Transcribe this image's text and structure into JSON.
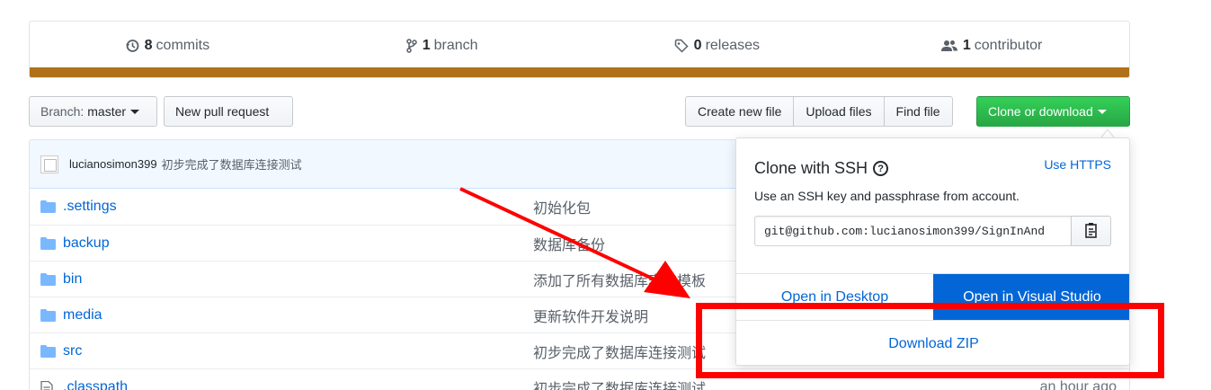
{
  "summary": {
    "commits": {
      "count": "8",
      "label": "commits",
      "icon": "history-icon"
    },
    "branches": {
      "count": "1",
      "label": "branch",
      "icon": "git-branch-icon"
    },
    "releases": {
      "count": "0",
      "label": "releases",
      "icon": "tag-icon"
    },
    "contributors": {
      "count": "1",
      "label": "contributor",
      "icon": "people-icon"
    },
    "language_color": "#b07219"
  },
  "toolbar": {
    "branch_prefix": "Branch:",
    "branch_name": "master",
    "new_pull_request": "New pull request",
    "create_new_file": "Create new file",
    "upload_files": "Upload files",
    "find_file": "Find file",
    "clone_or_download": "Clone or download"
  },
  "commit": {
    "author": "lucianosimon399",
    "message": "初步完成了数据库连接测试"
  },
  "files": [
    {
      "name": ".settings",
      "type": "folder",
      "message": "初始化包",
      "age": ""
    },
    {
      "name": "backup",
      "type": "folder",
      "message": "数据库备份",
      "age": ""
    },
    {
      "name": "bin",
      "type": "folder",
      "message": "添加了所有数据库表的模板",
      "age": ""
    },
    {
      "name": "media",
      "type": "folder",
      "message": "更新软件开发说明",
      "age": ""
    },
    {
      "name": "src",
      "type": "folder",
      "message": "初步完成了数据库连接测试",
      "age": ""
    },
    {
      "name": ".classpath",
      "type": "file",
      "message": "初步完成了数据库连接测试",
      "age": "an hour ago"
    }
  ],
  "clone_popup": {
    "title": "Clone with SSH",
    "use_https": "Use HTTPS",
    "description": "Use an SSH key and passphrase from account.",
    "url": "git@github.com:lucianosimon399/SignInAnd",
    "open_desktop": "Open in Desktop",
    "open_visual_studio": "Open in Visual Studio",
    "download_zip": "Download ZIP"
  },
  "colors": {
    "accent": "#0366d6",
    "clone_button": "#28a745",
    "annotation": "#ff0000"
  }
}
